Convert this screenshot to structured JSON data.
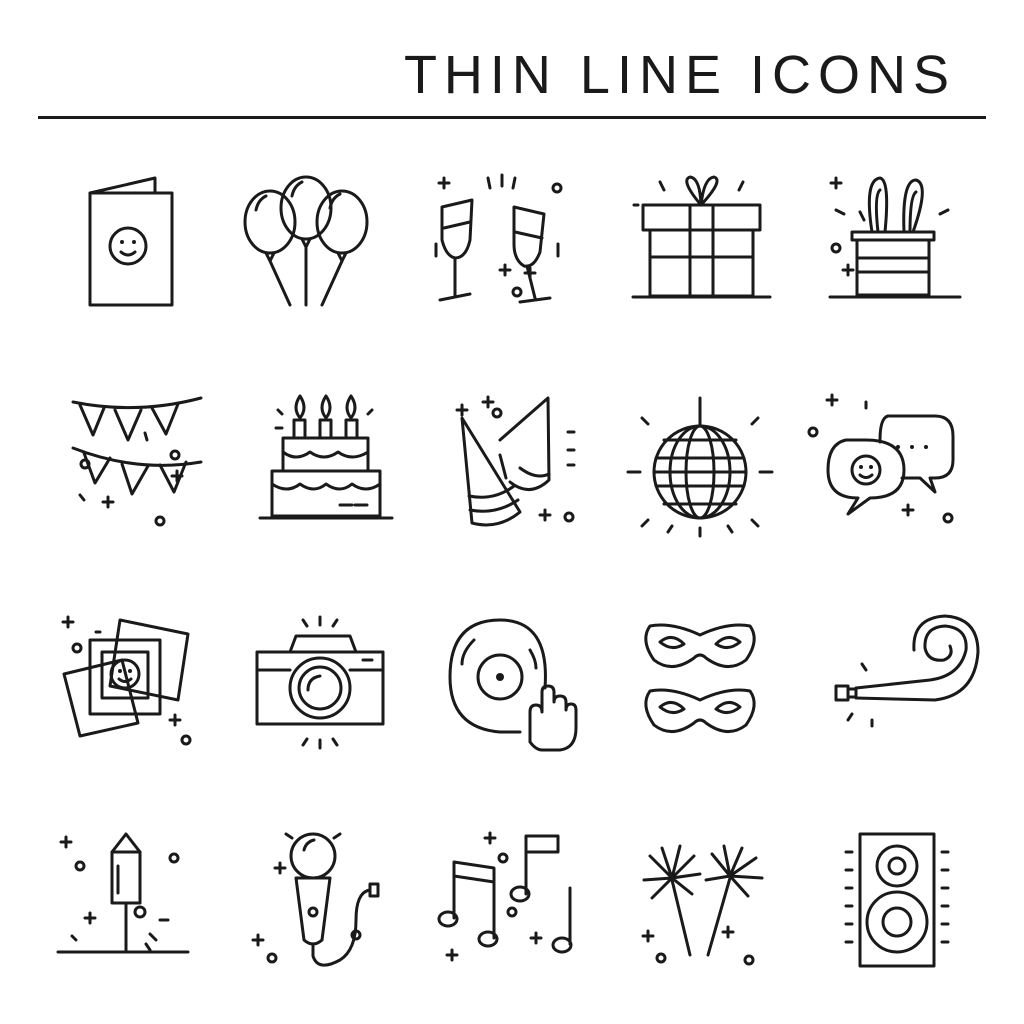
{
  "header": {
    "title": "THIN LINE ICONS"
  },
  "icons": [
    "greeting-card-icon",
    "balloons-icon",
    "champagne-glasses-icon",
    "gift-box-icon",
    "magic-hat-icon",
    "garland-icon",
    "birthday-cake-icon",
    "party-hats-icon",
    "disco-ball-icon",
    "chat-bubbles-icon",
    "photos-icon",
    "camera-icon",
    "dj-vinyl-icon",
    "carnival-masks-icon",
    "party-horn-icon",
    "firework-rocket-icon",
    "microphone-icon",
    "music-notes-icon",
    "sparklers-icon",
    "speaker-icon"
  ],
  "colors": {
    "ink": "#1a1a1a",
    "background": "#ffffff"
  }
}
